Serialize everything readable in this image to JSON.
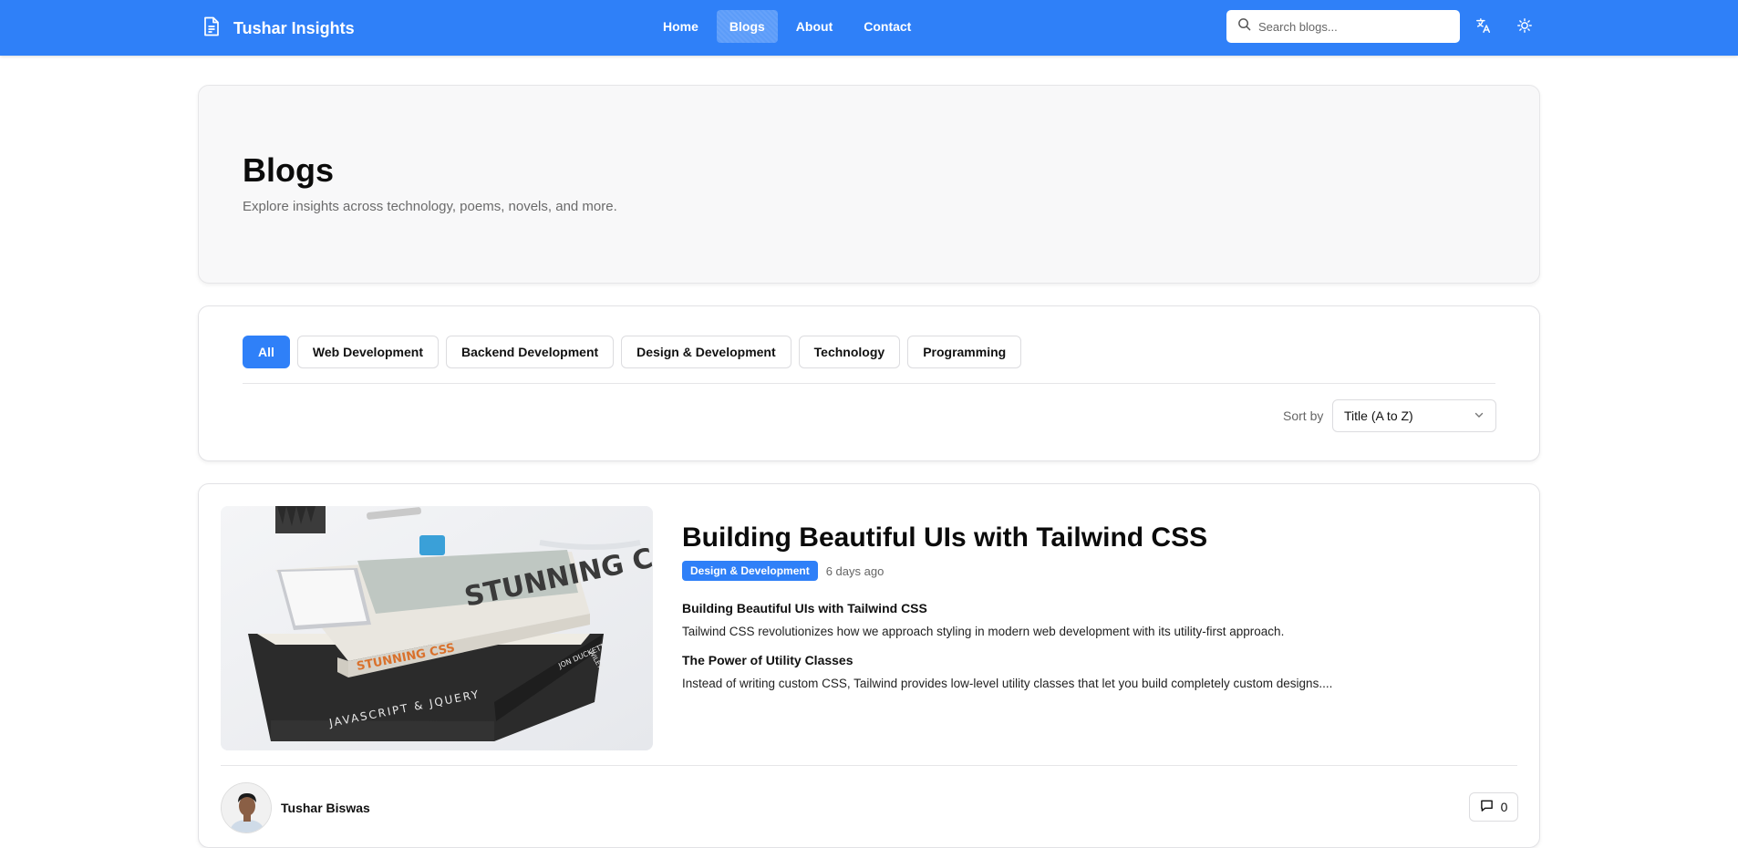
{
  "navbar": {
    "brand_title": "Tushar Insights",
    "links": [
      {
        "label": "Home",
        "active": false
      },
      {
        "label": "Blogs",
        "active": true
      },
      {
        "label": "About",
        "active": false
      },
      {
        "label": "Contact",
        "active": false
      }
    ],
    "search_placeholder": "Search blogs...",
    "accent_color": "#2f80f8"
  },
  "hero": {
    "title": "Blogs",
    "subtitle": "Explore insights across technology, poems, novels, and more."
  },
  "filters": {
    "categories": [
      {
        "label": "All",
        "active": true
      },
      {
        "label": "Web Development",
        "active": false
      },
      {
        "label": "Backend Development",
        "active": false
      },
      {
        "label": "Design & Development",
        "active": false
      },
      {
        "label": "Technology",
        "active": false
      },
      {
        "label": "Programming",
        "active": false
      }
    ],
    "sort_label": "Sort by",
    "sort_value": "Title (A to Z)"
  },
  "post": {
    "title": "Building Beautiful UIs with Tailwind CSS",
    "category": "Design & Development",
    "date": "6 days ago",
    "section1_heading": "Building Beautiful UIs with Tailwind CSS",
    "section1_text": "Tailwind CSS revolutionizes how we approach styling in modern web development with its utility-first approach.",
    "section2_heading": "The Power of Utility Classes",
    "section2_text": "Instead of writing custom CSS, Tailwind provides low-level utility classes that let you build completely custom designs....",
    "image_book_texts": [
      "STUNNING CSS",
      "JAVASCRIPT & JQUERY",
      "JON DUCKETT",
      "WILEY"
    ],
    "author": "Tushar Biswas",
    "comment_count": "0"
  }
}
